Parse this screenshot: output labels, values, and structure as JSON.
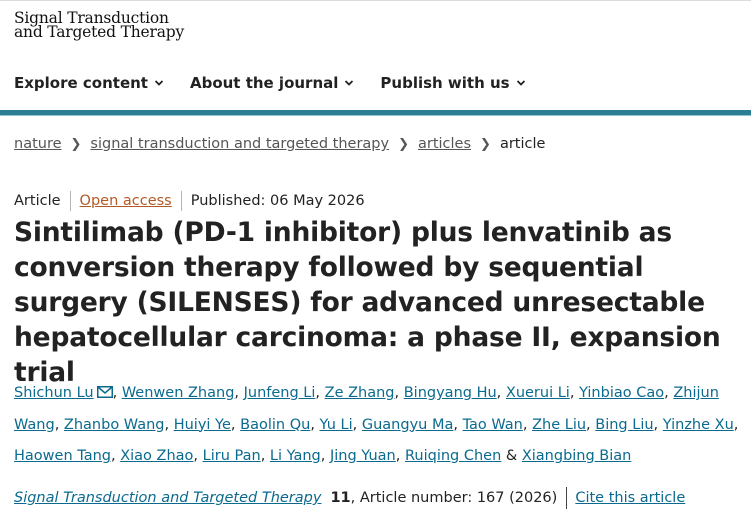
{
  "header": {
    "logo_line1": "Signal Transduction",
    "logo_line2": "and Targeted Therapy"
  },
  "nav": {
    "items": [
      {
        "label": "Explore content"
      },
      {
        "label": "About the journal"
      },
      {
        "label": "Publish with us"
      }
    ],
    "accent_color": "#2a7f93"
  },
  "breadcrumb": {
    "items": [
      "nature",
      "signal transduction and targeted therapy",
      "articles"
    ],
    "current": "article"
  },
  "article": {
    "type": "Article",
    "access": "Open access",
    "published": "Published: 06 May 2026",
    "title": "Sintilimab (PD-1 inhibitor) plus lenvatinib as conversion therapy followed by sequential surgery (SILENSES) for advanced unresectable hepatocellular carcinoma: a phase II, expansion trial",
    "authors": [
      "Shichun Lu",
      "Wenwen Zhang",
      "Junfeng Li",
      "Ze Zhang",
      "Bingyang Hu",
      "Xuerui Li",
      "Yinbiao Cao",
      "Zhijun Wang",
      "Zhanbo Wang",
      "Huiyi Ye",
      "Baolin Qu",
      "Yu Li",
      "Guangyu Ma",
      "Tao Wan",
      "Zhe Liu",
      "Bing Liu",
      "Yinzhe Xu",
      "Haowen Tang",
      "Xiao Zhao",
      "Liru Pan",
      "Li Yang",
      "Jing Yuan",
      "Ruiqing Chen",
      "Xiangbing Bian"
    ],
    "author_separator": ",",
    "last_author_joiner": "&"
  },
  "citation": {
    "journal": "Signal Transduction and Targeted Therapy",
    "volume": "11",
    "article_number": ", Article number: 167 (2026)",
    "cite_label": "Cite this article"
  },
  "colors": {
    "link": "#0b6a8e",
    "open_access": "#b35a24",
    "text": "#222222"
  }
}
